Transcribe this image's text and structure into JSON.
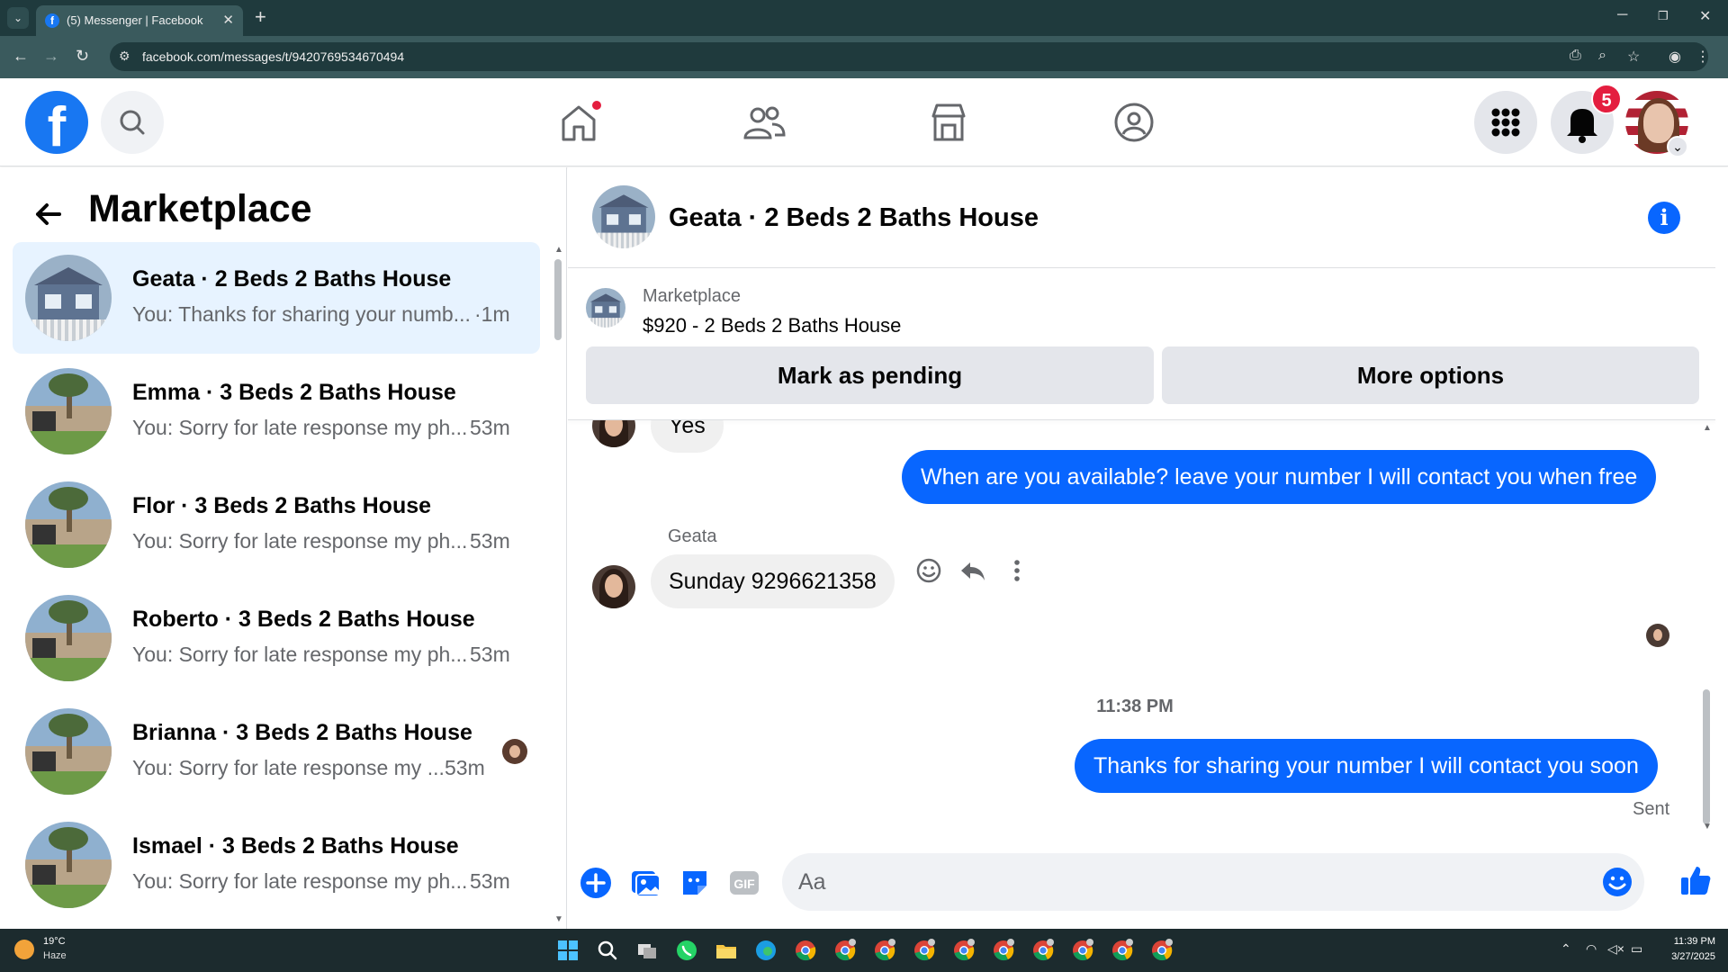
{
  "browser": {
    "tab_title": "(5) Messenger | Facebook",
    "url": "facebook.com/messages/t/9420769534670494"
  },
  "topbar": {
    "logo_letter": "f",
    "notification_count": "5"
  },
  "sidebar": {
    "title": "Marketplace",
    "conversations": [
      {
        "name": "Geata · 2 Beds 2 Baths House",
        "preview": "You: Thanks for sharing your numb...",
        "time": "·1m",
        "active": true
      },
      {
        "name": "Emma · 3 Beds 2 Baths House",
        "preview": "You: Sorry for late response my ph...",
        "time": "53m"
      },
      {
        "name": "Flor · 3 Beds 2 Baths House",
        "preview": "You: Sorry for late response my ph...",
        "time": "53m"
      },
      {
        "name": "Roberto · 3 Beds 2 Baths House",
        "preview": "You: Sorry for late response my ph...",
        "time": "53m"
      },
      {
        "name": "Brianna · 3 Beds 2 Baths House",
        "preview": "You: Sorry for late response my ...",
        "time": "53m"
      },
      {
        "name": "Ismael · 3 Beds 2 Baths House",
        "preview": "You: Sorry for late response my ph...",
        "time": "53m"
      }
    ]
  },
  "chat": {
    "title": "Geata · 2 Beds 2 Baths House",
    "marketplace_label": "Marketplace",
    "listing": "$920 - 2 Beds 2 Baths House",
    "mark_pending_label": "Mark as pending",
    "more_options_label": "More options",
    "messages": {
      "partial_incoming": "Yes",
      "outgoing_1": "When are you available? leave your number I will contact you when free",
      "sender": "Geata",
      "incoming_1": "Sunday 9296621358",
      "timestamp": "11:38 PM",
      "outgoing_2": "Thanks for sharing your number I will contact you soon",
      "status": "Sent"
    },
    "composer_placeholder": "Aa"
  },
  "taskbar": {
    "temperature": "19°C",
    "condition": "Haze",
    "time": "11:39 PM",
    "date": "3/27/2025"
  },
  "colors": {
    "brand_blue": "#1877f2",
    "message_blue": "#0866ff",
    "badge_red": "#e41e3f"
  }
}
